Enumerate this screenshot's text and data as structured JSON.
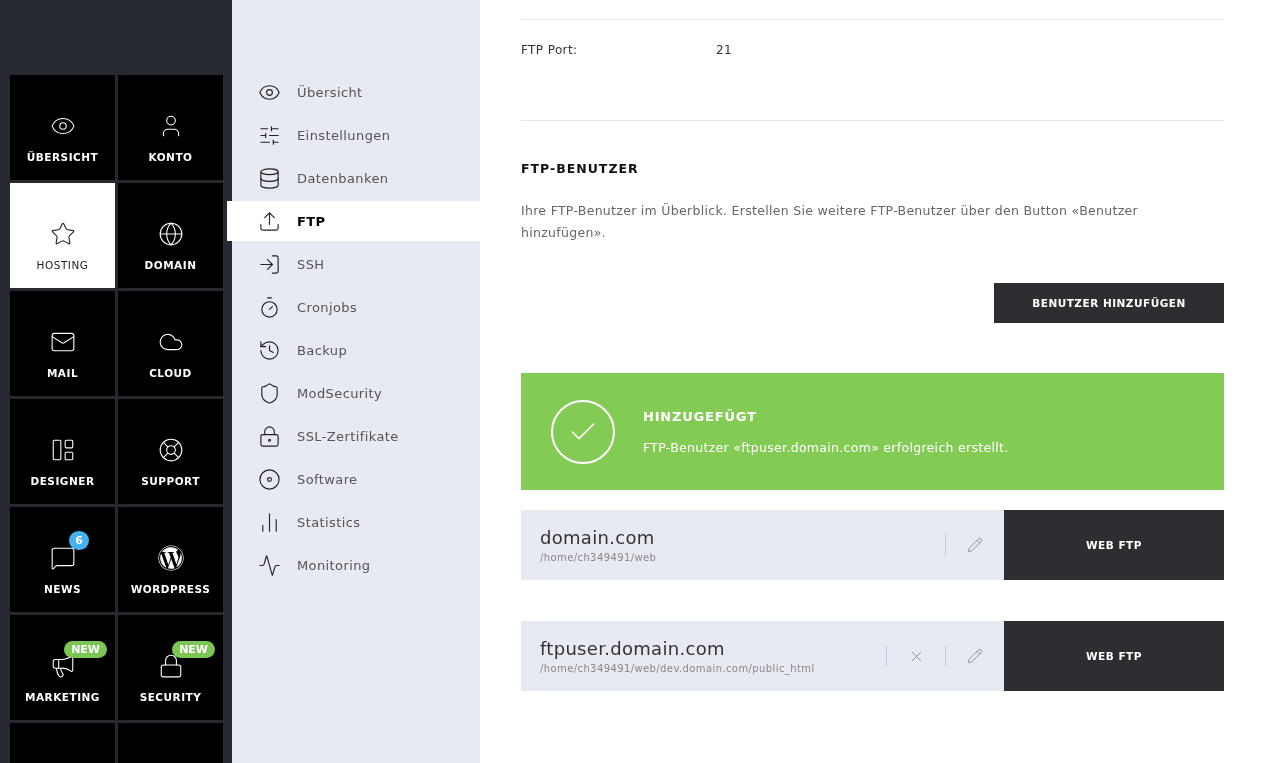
{
  "main_nav": {
    "items": [
      {
        "kind": "tile",
        "label": "ÜBERSICHT",
        "selected": false
      },
      {
        "kind": "tile",
        "label": "KONTO",
        "selected": false
      },
      {
        "kind": "tile",
        "label": "HOSTING",
        "selected": true
      },
      {
        "kind": "tile",
        "label": "DOMAIN",
        "selected": false
      },
      {
        "kind": "tile",
        "label": "MAIL",
        "selected": false
      },
      {
        "kind": "tile",
        "label": "CLOUD",
        "selected": false
      },
      {
        "kind": "tile",
        "label": "DESIGNER",
        "selected": false
      },
      {
        "kind": "tile",
        "label": "SUPPORT",
        "selected": false
      },
      {
        "kind": "tile",
        "label": "NEWS",
        "selected": false,
        "badge": {
          "kind": "count",
          "text": "6"
        }
      },
      {
        "kind": "tile",
        "label": "WORDPRESS",
        "selected": false
      },
      {
        "kind": "tile",
        "label": "MARKETING",
        "selected": false,
        "badge": {
          "kind": "new",
          "text": "NEW"
        }
      },
      {
        "kind": "tile",
        "label": "SECURITY",
        "selected": false,
        "badge": {
          "kind": "new",
          "text": "NEW"
        }
      },
      {
        "kind": "cut",
        "selected": false
      },
      {
        "kind": "cut",
        "selected": false
      }
    ]
  },
  "sub_nav": {
    "items": [
      {
        "label": "Übersicht",
        "selected": false
      },
      {
        "label": "Einstellungen",
        "selected": false
      },
      {
        "label": "Datenbanken",
        "selected": false
      },
      {
        "label": "FTP",
        "selected": true
      },
      {
        "label": "SSH",
        "selected": false
      },
      {
        "label": "Cronjobs",
        "selected": false
      },
      {
        "label": "Backup",
        "selected": false
      },
      {
        "label": "ModSecurity",
        "selected": false
      },
      {
        "label": "SSL-Zertifikate",
        "selected": false
      },
      {
        "label": "Software",
        "selected": false
      },
      {
        "label": "Statistics",
        "selected": false
      },
      {
        "label": "Monitoring",
        "selected": false
      }
    ]
  },
  "ftp_port": {
    "label": "FTP Port:",
    "value": "21"
  },
  "ftp_users": {
    "heading": "FTP-BENUTZER",
    "description": "Ihre FTP-Benutzer im Überblick. Erstellen Sie weitere FTP-Benutzer über den Button «Benutzer hinzufügen».",
    "add_button": "BENUTZER HINZUFÜGEN"
  },
  "notice": {
    "kind": "success",
    "title": "HINZUGEFÜGT",
    "message": "FTP-Benutzer «ftpuser.domain.com» erfolgreich erstellt."
  },
  "accounts": [
    {
      "name": "domain.com",
      "path": "/home/ch349491/web",
      "deletable": false,
      "button": "WEB FTP"
    },
    {
      "name": "ftpuser.domain.com",
      "path": "/home/ch349491/web/dev.domain.com/public_html",
      "deletable": true,
      "button": "WEB FTP"
    }
  ]
}
